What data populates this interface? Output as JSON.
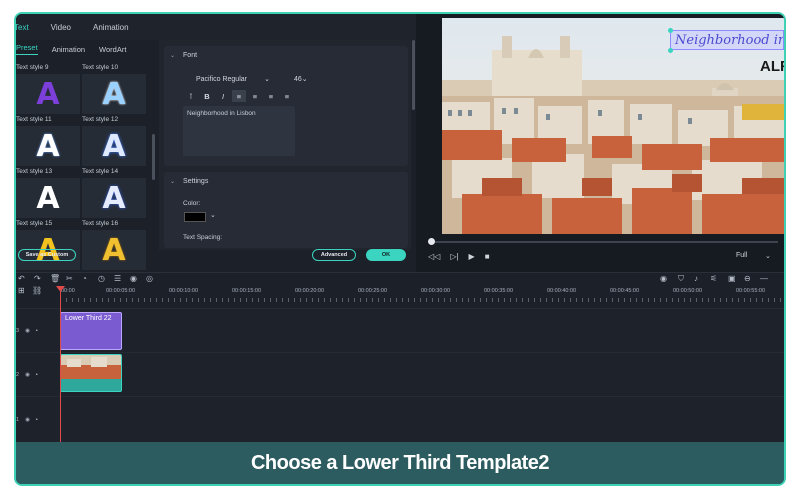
{
  "top_tabs": [
    "Text",
    "Video",
    "Animation"
  ],
  "sub_tabs": [
    "Preset",
    "Animation",
    "WordArt"
  ],
  "styles": [
    {
      "label": "Text style 9",
      "color": "#7c3fd9"
    },
    {
      "label": "Text style 10",
      "color": "#9ad1ff"
    },
    {
      "label": "Text style 11",
      "color": "#ffffff"
    },
    {
      "label": "Text style 12",
      "color": "#dfe9ff"
    },
    {
      "label": "Text style 13",
      "color": "#ffffff"
    },
    {
      "label": "Text style 14",
      "color": "#e6ecff"
    },
    {
      "label": "Text style 15",
      "color": "#f4c21f"
    },
    {
      "label": "Text style 16",
      "color": "#f0c030"
    }
  ],
  "style_glyph": "A",
  "font_section": {
    "title": "Font",
    "font_name": "Pacifico Regular",
    "font_size": "46",
    "text": "Neighborhood in Lisbon"
  },
  "format_buttons": [
    "⊺",
    "B",
    "I",
    "≡",
    "≡",
    "≡",
    "≡"
  ],
  "settings_section": {
    "title": "Settings",
    "color_label": "Color:",
    "spacing_label": "Text Spacing:"
  },
  "buttons": {
    "save": "Save as Custom",
    "advanced": "Advanced",
    "ok": "OK"
  },
  "preview": {
    "overlay_text": "Neighborhood in Lisbon",
    "brand": "ALF",
    "zoom": "Full"
  },
  "timeline": {
    "ticks": [
      "00:00",
      "00:00:05:00",
      "00:00:10:00",
      "00:00:15:00",
      "00:00:20:00",
      "00:00:25:00",
      "00:00:30:00",
      "00:00:35:00",
      "00:00:40:00",
      "00:00:45:00",
      "00:00:50:00",
      "00:00:55:00"
    ],
    "tracks": [
      "3",
      "2",
      "1",
      "1"
    ],
    "clip_title": "Lower Third 22"
  },
  "caption": "Choose a Lower Third Template2",
  "accent": "#3ad4c0"
}
